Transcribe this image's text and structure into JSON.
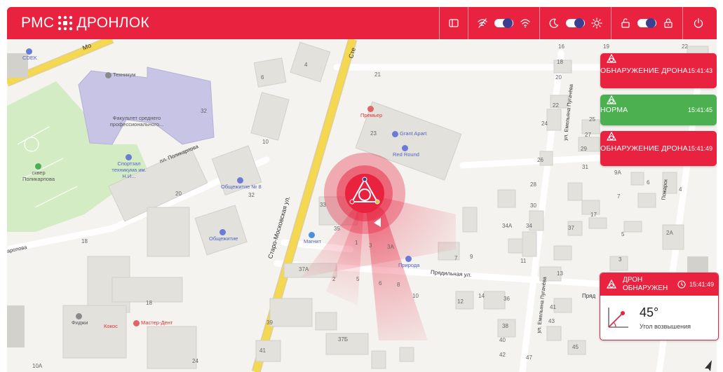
{
  "header": {
    "brand_left": "РМС",
    "brand_right": "ДРОНЛОК",
    "toggles": [
      {
        "name": "wifi",
        "state": "on"
      },
      {
        "name": "theme",
        "state": "on"
      },
      {
        "name": "lock",
        "state": "on"
      }
    ]
  },
  "alerts": [
    {
      "text": "ОБНАРУЖЕНИЕ ДРОНА",
      "time": "15:41:43",
      "status": "red"
    },
    {
      "text": "НОРМА",
      "time": "15:41:45",
      "status": "green"
    },
    {
      "text": "ОБНАРУЖЕНИЕ ДРОНА",
      "time": "15:41:49",
      "status": "red"
    }
  ],
  "detection_card": {
    "title": "ДРОН ОБНАРУЖЕН",
    "time": "15:41:49",
    "angle": "45°",
    "angle_label": "Угол возвышения"
  },
  "map": {
    "streets": {
      "staro_moskovskaya": "Старо-Московская ул.",
      "pugacheva_1": "ул. Емельяна Пугачёва",
      "pugacheva_2": "ул. Емельяна Пугачёва",
      "pugacheva_3": "ул. Емельяна Пугачёва",
      "predilnaya": "Прядильная ул.",
      "predilnaya_right": "Пряд",
      "polikarpova": "пл. Поликарпова",
      "pozharsk": "Пожарск",
      "aprova": "аропова",
      "mo": "Мо",
      "ste": "Сте"
    },
    "pois": {
      "cdek": "CDEK",
      "technikum": "Техникум",
      "fakultet": "Факультет среднего профессионального...",
      "sportzal": "Спортзал техникума им. Н.И...",
      "skver": "сквер Поликарпова",
      "obshezhitie8": "Общежитие № 8",
      "obshezhitie": "Общежитие",
      "magnit": "Магнит",
      "priroda": "Природа",
      "premier": "Премьер",
      "grant": "Grant Apart",
      "redround": "Red Round",
      "fidzhi": "Фиджи",
      "koks": "Кокос",
      "master": "Мастер-Дент"
    },
    "house_numbers": [
      "4",
      "6",
      "10",
      "16",
      "18",
      "20",
      "21",
      "22",
      "23",
      "24",
      "25",
      "26",
      "27",
      "28",
      "29",
      "30",
      "31",
      "32",
      "33",
      "34",
      "34А",
      "35",
      "36",
      "37",
      "37А",
      "38",
      "39",
      "40",
      "41",
      "42",
      "43",
      "45",
      "47",
      "12",
      "13",
      "14",
      "1",
      "2",
      "3",
      "3А",
      "5",
      "6",
      "7",
      "8",
      "9",
      "10",
      "11",
      "17",
      "2А",
      "3",
      "5",
      "7",
      "4",
      "6",
      "9А",
      "20",
      "18",
      "18",
      "24",
      "32",
      "37Б",
      "41",
      "10А",
      "19",
      "22",
      "P"
    ]
  }
}
